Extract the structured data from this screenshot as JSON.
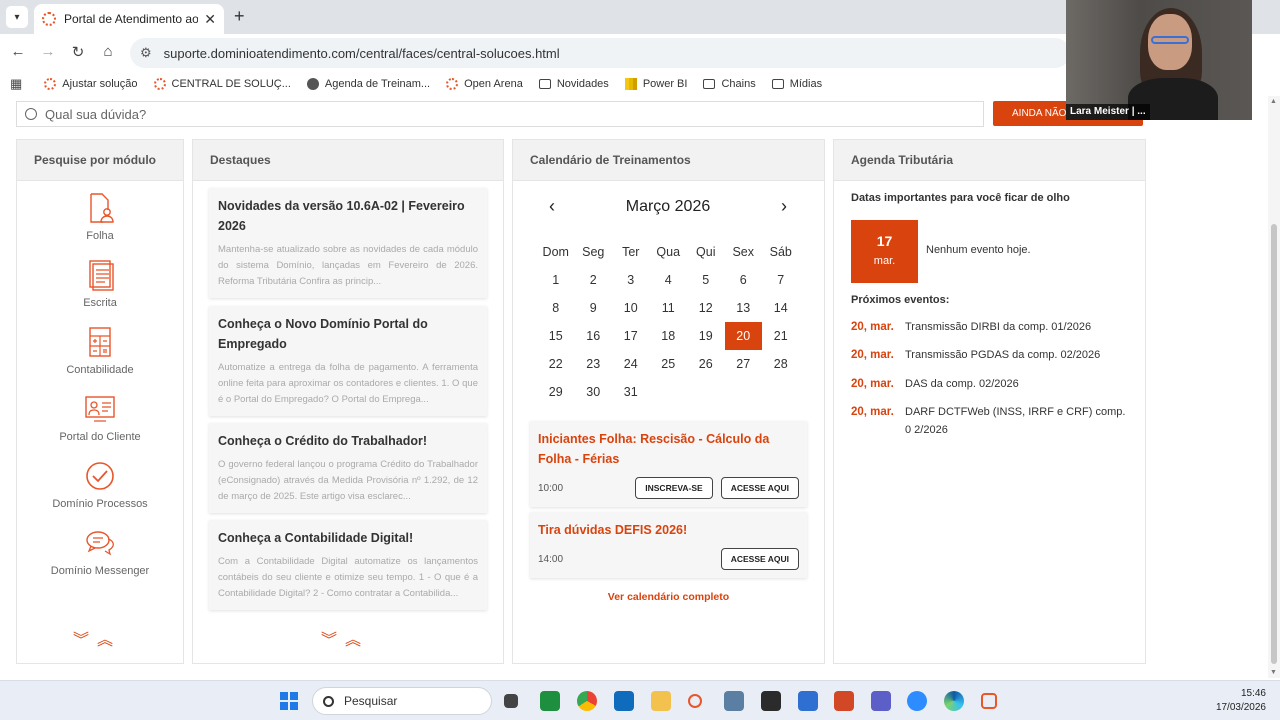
{
  "browser": {
    "tab_title": "Portal de Atendimento ao Clien",
    "url": "suporte.dominioatendimento.com/central/faces/central-solucoes.html",
    "bookmarks": [
      {
        "label": "Ajustar solução",
        "icon": "gear"
      },
      {
        "label": "CENTRAL DE SOLUÇ...",
        "icon": "gear"
      },
      {
        "label": "Agenda de Treinam...",
        "icon": "globe"
      },
      {
        "label": "Open Arena",
        "icon": "gear"
      },
      {
        "label": "Novidades",
        "icon": "folder"
      },
      {
        "label": "Power BI",
        "icon": "bars"
      },
      {
        "label": "Chains",
        "icon": "folder"
      },
      {
        "label": "Mídias",
        "icon": "folder"
      }
    ]
  },
  "search": {
    "placeholder": "Qual sua dúvida?",
    "cta_label": "AINDA NÃO S"
  },
  "modules": {
    "title": "Pesquise por módulo",
    "items": [
      {
        "label": "Folha",
        "icon": "person-document-icon"
      },
      {
        "label": "Escrita",
        "icon": "ledger-icon"
      },
      {
        "label": "Contabilidade",
        "icon": "calculator-icon"
      },
      {
        "label": "Portal do Cliente",
        "icon": "portal-icon"
      },
      {
        "label": "Domínio Processos",
        "icon": "checkmark-circle-icon"
      },
      {
        "label": "Domínio Messenger",
        "icon": "chat-bubbles-icon"
      }
    ]
  },
  "highlights": {
    "title": "Destaques",
    "cards": [
      {
        "title": "Novidades da versão 10.6A-02 | Fevereiro 2026",
        "text": "Mantenha-se atualizado sobre as novidades de cada módulo do sistema Domínio, lançadas em Fevereiro de 2026.              Reforma Tributária Confira as princip..."
      },
      {
        "title": "Conheça o Novo Domínio Portal do Empregado",
        "text": "Automatize a entrega da folha de pagamento. A ferramenta online feita para aproximar os contadores e clientes.    1. O que é o Portal do Empregado?    O Portal do Emprega..."
      },
      {
        "title": "Conheça o Crédito do Trabalhador!",
        "text": "O governo federal lançou o programa Crédito do Trabalhador (eConsignado) através da Medida Provisória nº 1.292, de 12 de março de 2025. Este artigo visa esclarec..."
      },
      {
        "title": "Conheça a Contabilidade Digital!",
        "text": "Com a Contabilidade Digital automatize os lançamentos contábeis do seu cliente e otimize seu tempo.   1 - O que é a Contabilidade Digital? 2 - Como contratar a Contabilida..."
      }
    ]
  },
  "calendar": {
    "title": "Calendário de Treinamentos",
    "month_label": "Março 2026",
    "prev": "‹",
    "next": "›",
    "weekdays": [
      "Dom",
      "Seg",
      "Ter",
      "Qua",
      "Qui",
      "Sex",
      "Sáb"
    ],
    "first_weekday_index": 0,
    "days_in_month": 31,
    "highlighted_day": 20,
    "events": [
      {
        "title": "Iniciantes Folha: Rescisão - Cálculo da Folha - Férias",
        "time": "10:00",
        "btn_subscribe": "INSCREVA-SE",
        "btn_access": "ACESSE AQUI"
      },
      {
        "title": "Tira dúvidas DEFIS 2026!",
        "time": "14:00",
        "btn_access": "ACESSE AQUI"
      }
    ],
    "full_link": "Ver calendário completo"
  },
  "agenda": {
    "title": "Agenda Tributária",
    "subtitle": "Datas importantes para você ficar de olho",
    "today_day": "17",
    "today_month": "mar.",
    "no_event": "Nenhum evento hoje.",
    "next_title": "Próximos eventos:",
    "items": [
      {
        "date": "20, mar.",
        "text": "Transmissão DIRBI da comp. 01/2026"
      },
      {
        "date": "20, mar.",
        "text": "Transmissão PGDAS da comp. 02/2026"
      },
      {
        "date": "20, mar.",
        "text": "DAS da comp. 02/2026"
      },
      {
        "date": "20, mar.",
        "text": "DARF DCTFWeb (INSS, IRRF e CRF) comp. 0 2/2026"
      }
    ]
  },
  "video": {
    "name": "Lara Meister | ..."
  },
  "taskbar": {
    "search_label": "Pesquisar",
    "time": "15:46",
    "date": "17/03/2026"
  },
  "colors": {
    "accent": "#d8430e"
  }
}
